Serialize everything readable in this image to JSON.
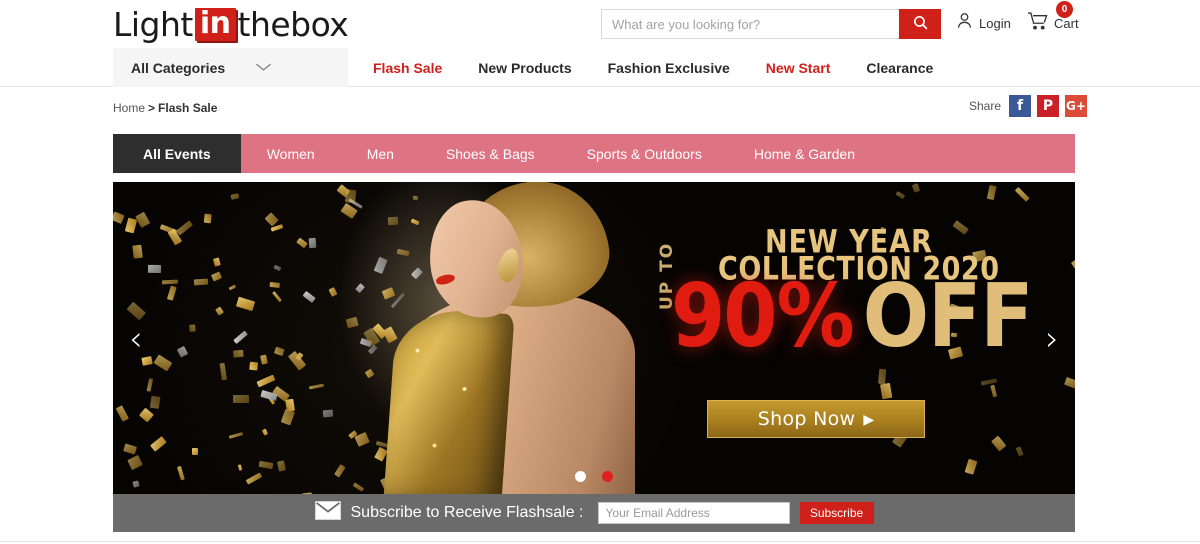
{
  "header": {
    "logo": {
      "part1": "Light",
      "part2": "in",
      "part3": "thebox"
    },
    "search": {
      "placeholder": "What are you looking for?",
      "value": "",
      "icon": "search-icon"
    },
    "login": {
      "label": "Login",
      "icon": "user-icon"
    },
    "cart": {
      "label": "Cart",
      "count": "0",
      "icon": "cart-icon"
    }
  },
  "nav": {
    "all_categories": {
      "label": "All Categories",
      "icon": "chevron-down-icon"
    },
    "links": [
      {
        "label": "Flash Sale",
        "accent": true
      },
      {
        "label": "New Products",
        "accent": false
      },
      {
        "label": "Fashion Exclusive",
        "accent": false
      },
      {
        "label": "New Start",
        "accent": true
      },
      {
        "label": "Clearance",
        "accent": false
      }
    ]
  },
  "breadcrumb": {
    "home": "Home",
    "separator": ">",
    "current": "Flash Sale"
  },
  "share": {
    "label": "Share",
    "buttons": [
      {
        "name": "facebook",
        "glyph": "f",
        "color": "#3b5998"
      },
      {
        "name": "pinterest",
        "glyph": "P",
        "color": "#cb2027"
      },
      {
        "name": "google-plus",
        "glyph": "G+",
        "color": "#dd4b39"
      }
    ]
  },
  "category_tabs": [
    {
      "label": "All Events",
      "active": true
    },
    {
      "label": "Women",
      "active": false
    },
    {
      "label": "Men",
      "active": false
    },
    {
      "label": "Shoes & Bags",
      "active": false
    },
    {
      "label": "Sports & Outdoors",
      "active": false
    },
    {
      "label": "Home & Garden",
      "active": false
    }
  ],
  "banner": {
    "headline_1": "NEW YEAR",
    "headline_2": "COLLECTION 2020",
    "up_to": "UP TO",
    "discount_number": "90",
    "discount_percent": "%",
    "discount_off": "OFF",
    "cta_label": "Shop Now",
    "cta_arrow": "▶",
    "prev_arrow": "‹",
    "next_arrow": "›",
    "dots": [
      {
        "active": true
      },
      {
        "active": false
      }
    ],
    "colors": {
      "gold": "#e0bd79",
      "red": "#e01b10",
      "cta_bg": "#a97f1e"
    }
  },
  "subscribe": {
    "icon": "envelope-icon",
    "text": "Subscribe to Receive Flashsale :",
    "placeholder": "Your Email Address",
    "value": "",
    "button_label": "Subscribe"
  }
}
